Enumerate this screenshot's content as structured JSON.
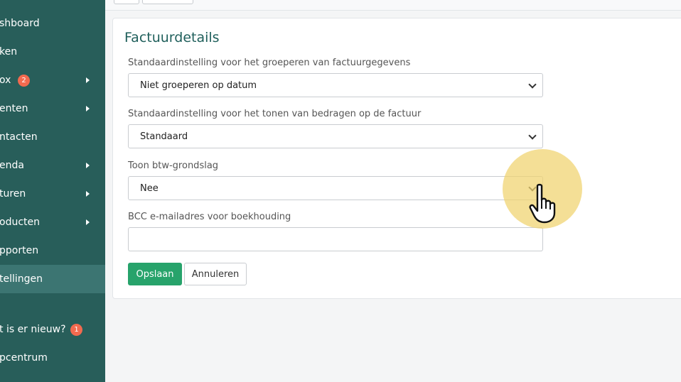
{
  "sidebar": {
    "items": [
      {
        "label": "shboard"
      },
      {
        "label": "ken"
      },
      {
        "label": "ox",
        "badge": "2"
      },
      {
        "label": "enten"
      },
      {
        "label": "ntacten"
      },
      {
        "label": "enda"
      },
      {
        "label": "turen"
      },
      {
        "label": "oducten"
      },
      {
        "label": "pporten"
      },
      {
        "label": "tellingen"
      },
      {
        "label": "t is er nieuw?",
        "badge": "1"
      },
      {
        "label": "pcentrum"
      }
    ]
  },
  "card": {
    "title": "Factuurdetails",
    "fields": [
      {
        "label": "Standaardinstelling voor het groeperen van factuurgegevens",
        "value": "Niet groeperen op datum"
      },
      {
        "label": "Standaardinstelling voor het tonen van bedragen op de factuur",
        "value": "Standaard"
      },
      {
        "label": "Toon btw-grondslag",
        "value": "Nee"
      },
      {
        "label": "BCC e-mailadres voor boekhouding",
        "value": ""
      }
    ],
    "save_label": "Opslaan",
    "cancel_label": "Annuleren"
  },
  "colors": {
    "sidebar_bg": "#285e5a",
    "sidebar_active": "#3c7572",
    "accent": "#27a36b",
    "title": "#1f5f5b",
    "badge": "#f26a4f"
  }
}
